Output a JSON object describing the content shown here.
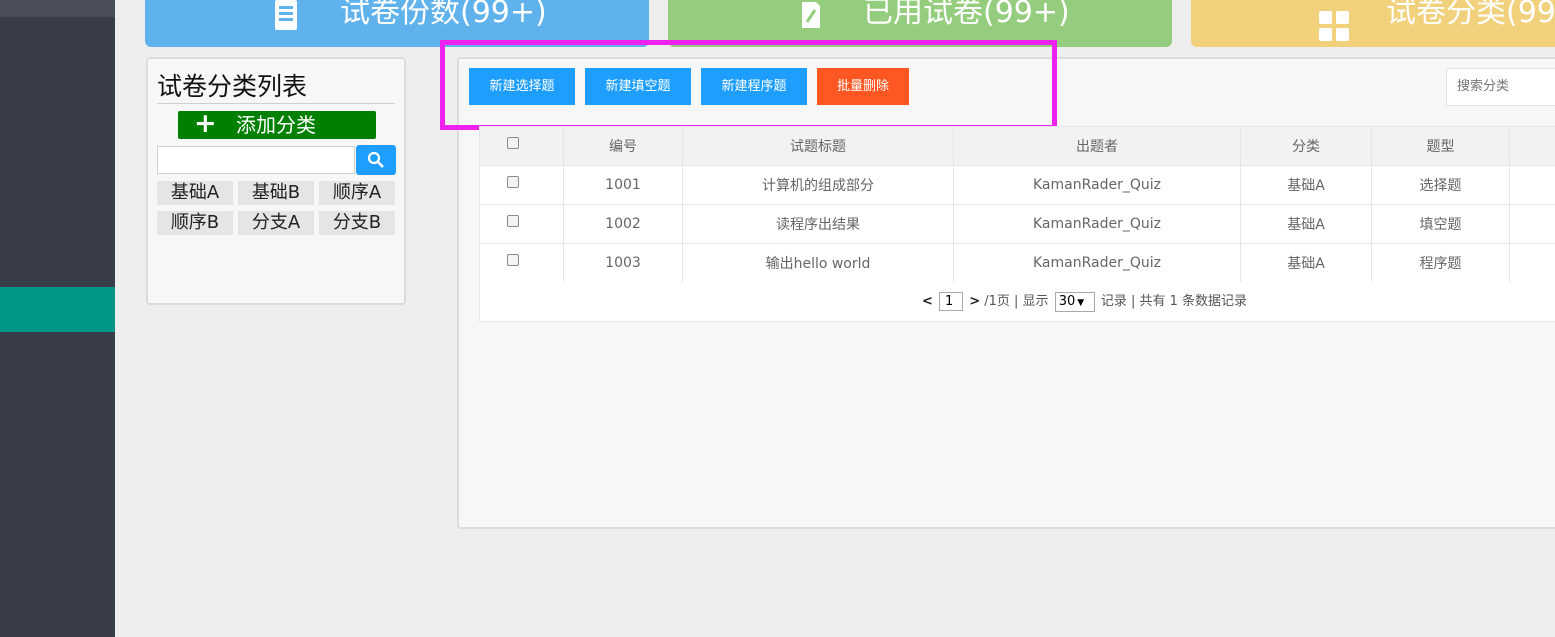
{
  "stat_cards": [
    {
      "label": "试卷份数(99+)",
      "icon": "document-icon",
      "color": "#5fb2ec"
    },
    {
      "label": "已用试卷(99+)",
      "icon": "edit-icon",
      "color": "#94cd7e"
    },
    {
      "label": "试卷分类(99",
      "icon": "grid-icon",
      "color": "#f1d17c"
    }
  ],
  "category_panel": {
    "title": "试卷分类列表",
    "add_button": "添加分类",
    "search_value": "",
    "tags": [
      "基础A",
      "基础B",
      "顺序A",
      "顺序B",
      "分支A",
      "分支B"
    ]
  },
  "toolbar": {
    "new_choice": "新建选择题",
    "new_fill": "新建填空题",
    "new_program": "新建程序题",
    "batch_delete": "批量删除",
    "search_placeholder": "搜索分类"
  },
  "table": {
    "headers": [
      "",
      "编号",
      "试题标题",
      "出题者",
      "分类",
      "题型",
      ""
    ],
    "rows": [
      {
        "id": "1001",
        "title": "计算机的组成部分",
        "author": "KamanRader_Quiz",
        "category": "基础A",
        "type": "选择题"
      },
      {
        "id": "1002",
        "title": "读程序出结果",
        "author": "KamanRader_Quiz",
        "category": "基础A",
        "type": "填空题"
      },
      {
        "id": "1003",
        "title": "输出hello world",
        "author": "KamanRader_Quiz",
        "category": "基础A",
        "type": "程序题"
      }
    ]
  },
  "pagination": {
    "prev": "<",
    "current_page": "1",
    "next": ">",
    "total_pages": "/1页",
    "show_label": "| 显示",
    "page_size": "30",
    "records_text": "记录 | 共有 1 条数据记录"
  },
  "colors": {
    "sidebar": "#393d49",
    "sidebar_active": "#009688",
    "primary_button": "#1e9fff",
    "danger_button": "#ff5722",
    "add_button": "#008000",
    "highlight": "#ee22ee"
  }
}
